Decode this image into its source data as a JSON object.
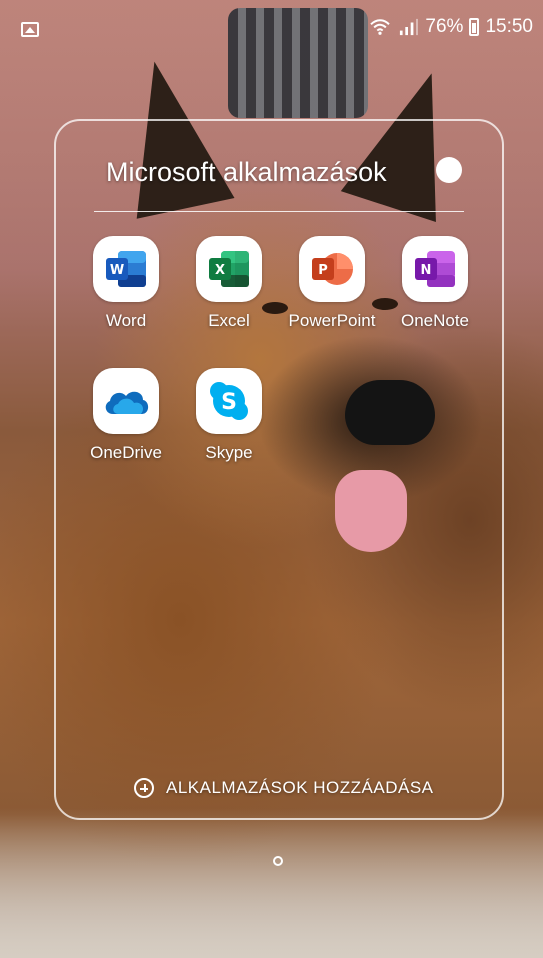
{
  "status_bar": {
    "battery": "76%",
    "time": "15:50",
    "icons": [
      "image-icon",
      "wifi-icon",
      "signal-icon",
      "battery-icon"
    ]
  },
  "folder": {
    "title": "Microsoft alkalmazások",
    "add_apps_label": "ALKALMAZÁSOK HOZZÁADÁSA",
    "apps": [
      {
        "label": "Word",
        "icon": "word-icon",
        "color": "#185ABD"
      },
      {
        "label": "Excel",
        "icon": "excel-icon",
        "color": "#107C41"
      },
      {
        "label": "PowerPoint",
        "icon": "powerpoint-icon",
        "color": "#C43E1C"
      },
      {
        "label": "OneNote",
        "icon": "onenote-icon",
        "color": "#7719AA"
      },
      {
        "label": "OneDrive",
        "icon": "onedrive-icon",
        "color": "#0F6CBD"
      },
      {
        "label": "Skype",
        "icon": "skype-icon",
        "color": "#00AFF0"
      }
    ]
  }
}
